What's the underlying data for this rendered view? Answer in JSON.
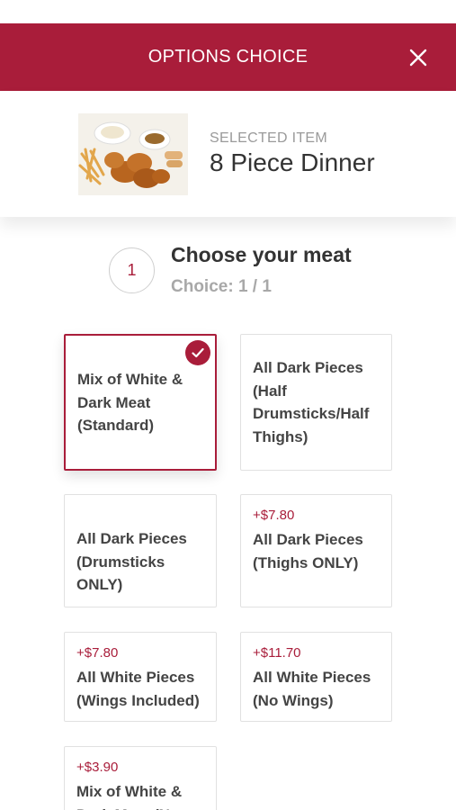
{
  "header": {
    "title": "OPTIONS CHOICE",
    "close_icon": "close-icon"
  },
  "selected": {
    "label": "SELECTED ITEM",
    "name": "8 Piece Dinner",
    "image": "chicken-dinner-photo"
  },
  "step": {
    "number": "1",
    "title": "Choose your meat",
    "choice": "Choice: 1 / 1"
  },
  "options": [
    {
      "price": "",
      "label": "Mix of White & Dark Meat (Standard)",
      "selected": true
    },
    {
      "price": "",
      "label": "All Dark Pieces (Half Drumsticks/Half Thighs)",
      "selected": false
    },
    {
      "price": "",
      "label": "All Dark Pieces (Drumsticks ONLY)",
      "selected": false
    },
    {
      "price": "+$7.80",
      "label": "All Dark Pieces (Thighs ONLY)",
      "selected": false
    },
    {
      "price": "+$7.80",
      "label": "All White Pieces (Wings Included)",
      "selected": false
    },
    {
      "price": "+$11.70",
      "label": "All White Pieces (No Wings)",
      "selected": false
    },
    {
      "price": "+$3.90",
      "label": "Mix of White & Dark Meat (N",
      "selected": false
    }
  ],
  "colors": {
    "accent": "#a91d3a",
    "muted": "#a8a8a8"
  }
}
